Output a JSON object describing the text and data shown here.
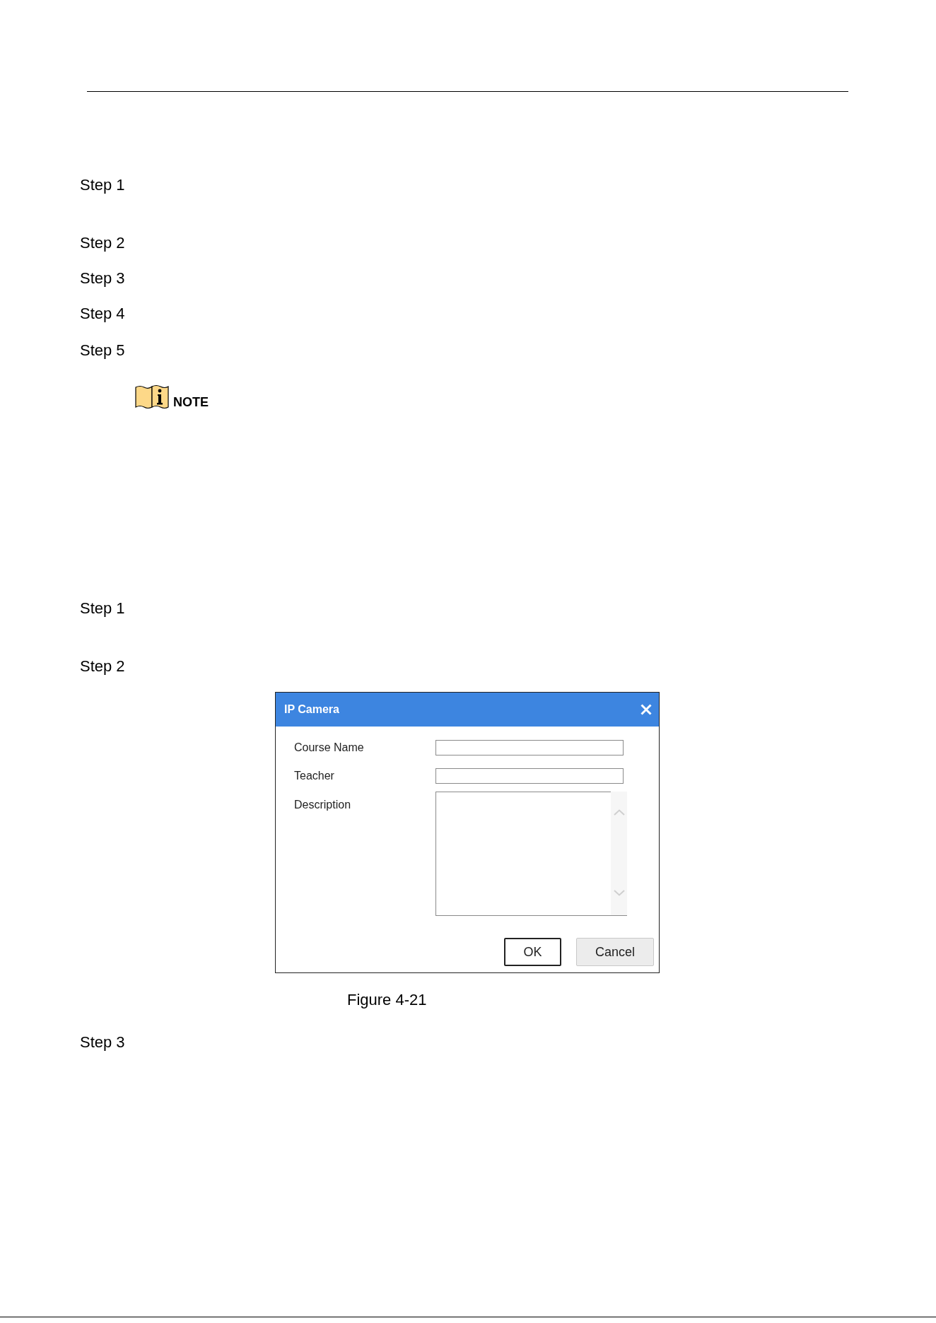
{
  "content": [
    {
      "kind": "step",
      "label": "Step 1"
    },
    {
      "kind": "step",
      "label": "Step 2"
    },
    {
      "kind": "step",
      "label": "Step 3"
    },
    {
      "kind": "step",
      "label": "Step 4"
    },
    {
      "kind": "step",
      "label": "Step 5"
    },
    {
      "kind": "note",
      "label": "NOTE"
    },
    {
      "kind": "step",
      "label": "Step 1"
    },
    {
      "kind": "step",
      "label": "Step 2"
    },
    {
      "kind": "figure",
      "dialog": {
        "title": "IP Camera",
        "fields": [
          {
            "kind": "text",
            "label": "Course Name"
          },
          {
            "kind": "text",
            "label": "Teacher"
          },
          {
            "kind": "textarea",
            "label": "Description"
          }
        ],
        "buttons": [
          {
            "label": "OK",
            "default": true
          },
          {
            "label": "Cancel",
            "default": false
          }
        ]
      },
      "caption": "Figure 4-21"
    },
    {
      "kind": "step",
      "label": "Step 3"
    }
  ]
}
